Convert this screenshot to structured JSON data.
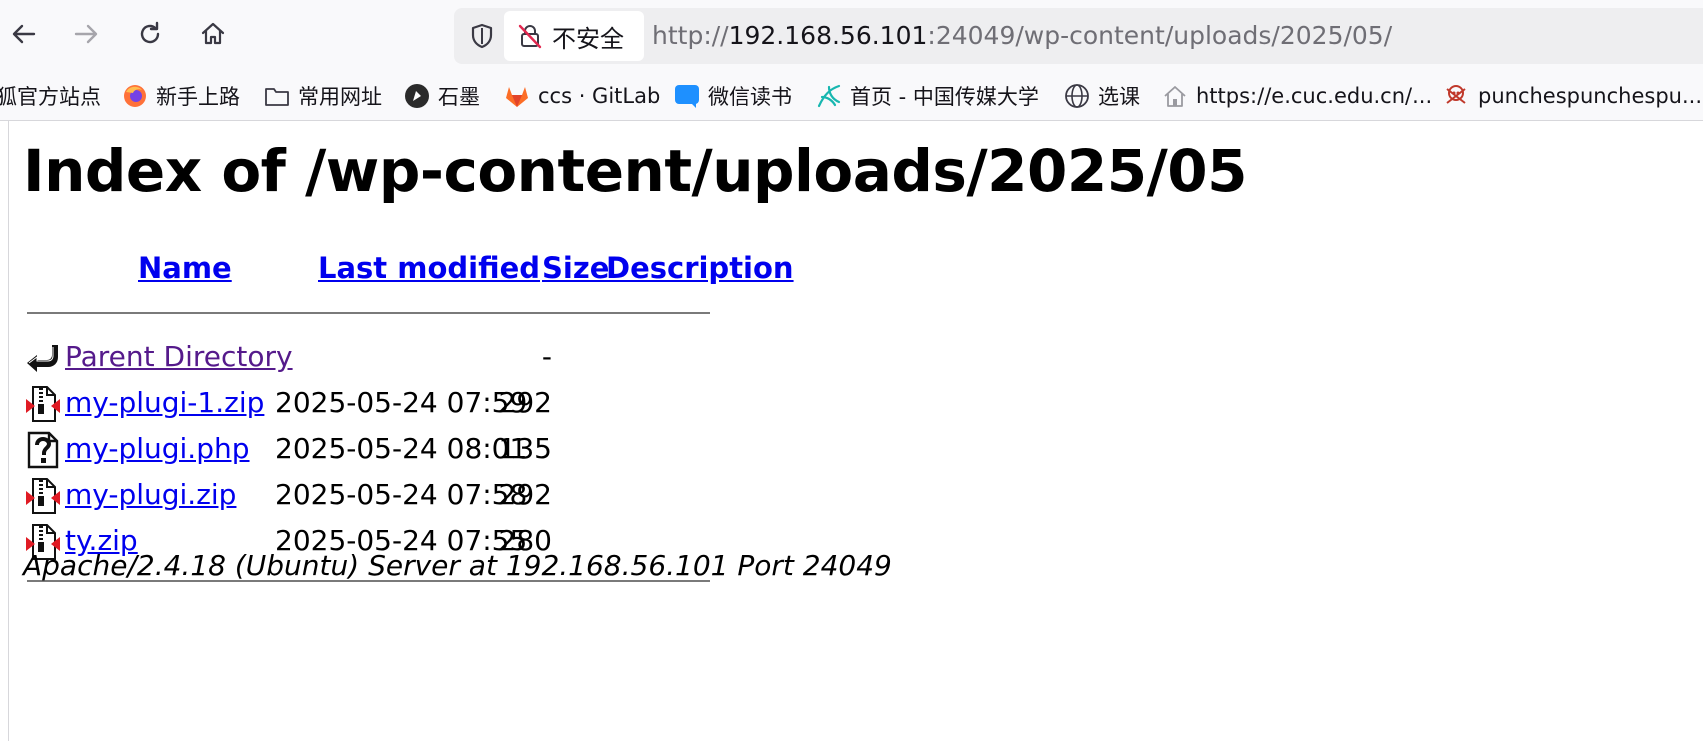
{
  "browser": {
    "security_label": "不安全",
    "url": {
      "scheme": "http://",
      "host": "192.168.56.101",
      "rest": ":24049/wp-content/uploads/2025/05/"
    },
    "bookmarks": [
      {
        "label": "狐官方站点",
        "icon": "firefox-icon"
      },
      {
        "label": "新手上路",
        "icon": "firefox-icon"
      },
      {
        "label": "常用网址",
        "icon": "folder-icon"
      },
      {
        "label": "石墨",
        "icon": "shimo-icon"
      },
      {
        "label": "ccs · GitLab",
        "icon": "gitlab-icon"
      },
      {
        "label": "微信读书",
        "icon": "weread-icon"
      },
      {
        "label": "首页 - 中国传媒大学",
        "icon": "cuc-icon"
      },
      {
        "label": "选课",
        "icon": "globe-icon"
      },
      {
        "label": "https://e.cuc.edu.cn/...",
        "icon": "house-icon"
      },
      {
        "label": "punchespunchespu...",
        "icon": "skull-icon"
      }
    ]
  },
  "page": {
    "title": "Index of /wp-content/uploads/2025/05",
    "columns": {
      "name": "Name",
      "last_modified": "Last modified",
      "size": "Size",
      "description": "Description"
    },
    "rows": [
      {
        "name": "Parent Directory",
        "date": "",
        "size": "-",
        "icon": "back-arrow-icon"
      },
      {
        "name": "my-plugi-1.zip",
        "date": "2025-05-24 07:59",
        "size": "292",
        "icon": "compressed-file-icon"
      },
      {
        "name": "my-plugi.php",
        "date": "2025-05-24 08:01",
        "size": "135",
        "icon": "unknown-file-icon"
      },
      {
        "name": "my-plugi.zip",
        "date": "2025-05-24 07:58",
        "size": "292",
        "icon": "compressed-file-icon"
      },
      {
        "name": "ty.zip",
        "date": "2025-05-24 07:55",
        "size": "280",
        "icon": "compressed-file-icon"
      }
    ],
    "server_signature": "Apache/2.4.18 (Ubuntu) Server at 192.168.56.101 Port 24049"
  }
}
